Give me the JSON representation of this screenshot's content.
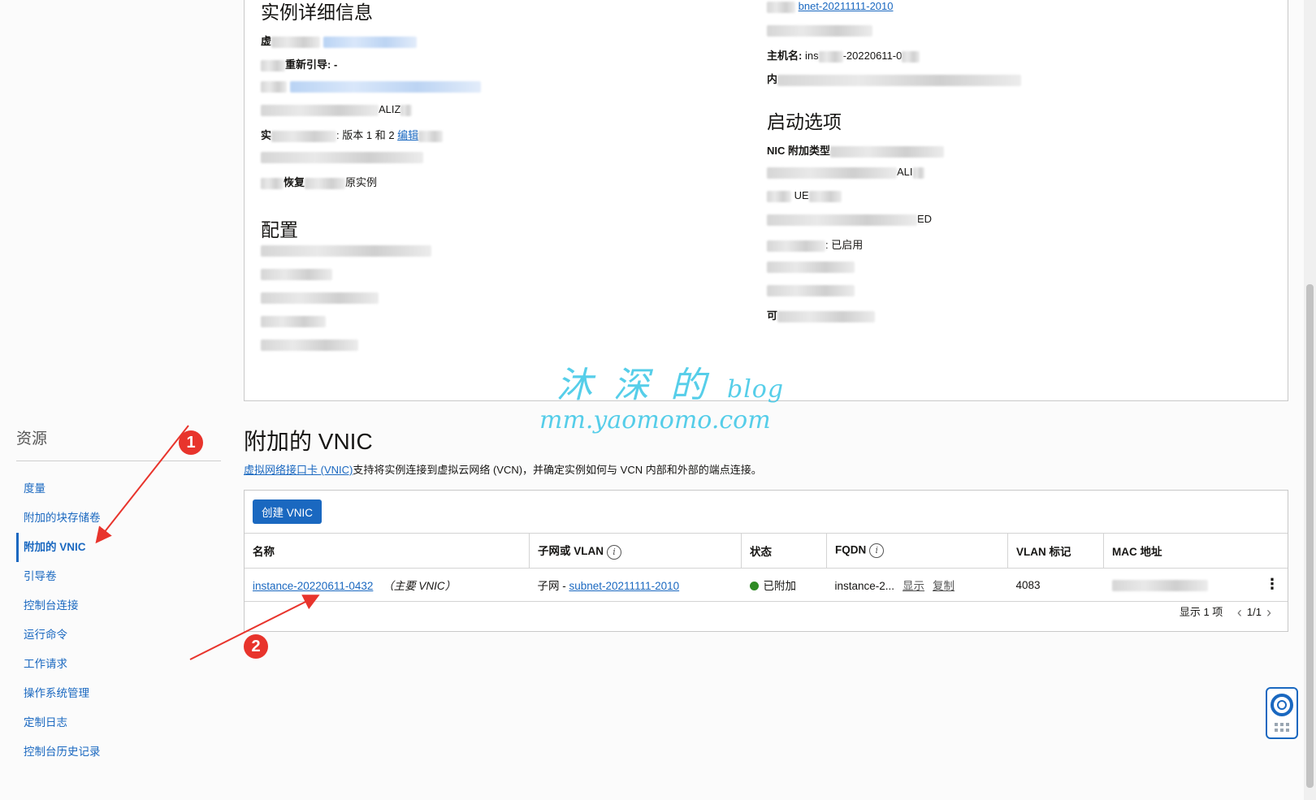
{
  "details": {
    "instance_section_title": "实例详细信息",
    "left_rows": [
      {
        "label": "虚",
        "value": ""
      },
      {
        "label": "重新引导: -",
        "value": ""
      },
      {
        "label": "",
        "value": ""
      },
      {
        "label": "",
        "value": "ALIZ"
      },
      {
        "label": "实",
        "value": "版本 1 和 2",
        "link": "编辑"
      },
      {
        "label": "",
        "value": ""
      },
      {
        "label": "恢复",
        "value": "原实例"
      }
    ],
    "config_section_title": "配置",
    "right_rows_top": [
      {
        "label": "",
        "link": "bnet-20211111-2010"
      },
      {
        "label": "",
        "value": ""
      },
      {
        "label": "主机名:",
        "value": "ins",
        "value2": "-20220611-0"
      },
      {
        "label": "内",
        "value": ""
      }
    ],
    "launch_section_title": "启动选项",
    "right_rows_launch": [
      {
        "label": "NIC 附加类型",
        "value": ""
      },
      {
        "label": "",
        "value": "ALI"
      },
      {
        "label": "",
        "value": "UE"
      },
      {
        "label": "",
        "value": "ED"
      },
      {
        "label": "",
        "value": ": 已启用"
      },
      {
        "label": "",
        "value": ""
      },
      {
        "label": "",
        "value": ""
      },
      {
        "label": "可",
        "value": ""
      }
    ]
  },
  "sidebar": {
    "title": "资源",
    "items": [
      {
        "label": "度量"
      },
      {
        "label": "附加的块存储卷"
      },
      {
        "label": "附加的 VNIC"
      },
      {
        "label": "引导卷"
      },
      {
        "label": "控制台连接"
      },
      {
        "label": "运行命令"
      },
      {
        "label": "工作请求"
      },
      {
        "label": "操作系统管理"
      },
      {
        "label": "定制日志"
      },
      {
        "label": "控制台历史记录"
      }
    ],
    "active_index": 2
  },
  "vnic": {
    "title": "附加的 VNIC",
    "desc_link": "虚拟网络接口卡 (VNIC)",
    "desc_text": "支持将实例连接到虚拟云网络 (VCN)，并确定实例如何与 VCN 内部和外部的端点连接。",
    "create_button": "创建 VNIC",
    "columns": [
      "名称",
      "子网或 VLAN",
      "状态",
      "FQDN",
      "VLAN 标记",
      "MAC 地址"
    ],
    "rows": [
      {
        "name": "instance-20220611-0432",
        "name_note": "（主要 VNIC）",
        "subnet_prefix": "子网 - ",
        "subnet": "subnet-20211111-2010",
        "status": "已附加",
        "fqdn": "instance-2...",
        "fqdn_show": "显示",
        "fqdn_copy": "复制",
        "vlan_tag": "4083",
        "mac": ""
      }
    ],
    "pager_count": "显示 1 项",
    "pager_page": "1/1"
  },
  "watermark": {
    "line1": "沐 深 的",
    "line1_suffix": "blog",
    "line2": "mm.yaomomo.com"
  },
  "badges": [
    "1",
    "2"
  ],
  "colors": {
    "link": "#1a68c0",
    "status_ok": "#2e8b24",
    "badge": "#e8342c",
    "watermark": "#39c6e6"
  }
}
